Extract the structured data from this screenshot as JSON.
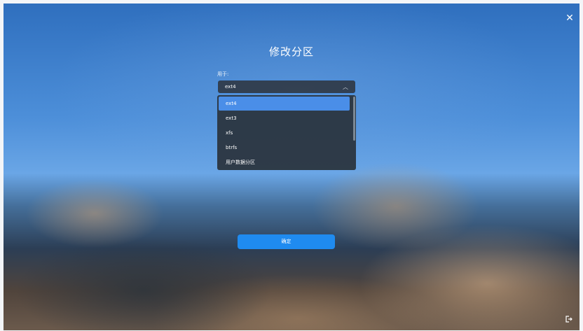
{
  "dialog": {
    "title": "修改分区",
    "close_icon": "close-icon",
    "field_label": "用于:",
    "select": {
      "value": "ext4",
      "chevron_icon": "chevron-up-icon"
    },
    "options": [
      {
        "label": "ext4",
        "selected": true
      },
      {
        "label": "ext3",
        "selected": false
      },
      {
        "label": "xfs",
        "selected": false
      },
      {
        "label": "btrfs",
        "selected": false
      },
      {
        "label": "用户数据分区",
        "selected": false
      }
    ],
    "confirm_label": "确定"
  },
  "footer": {
    "exit_icon": "logout-icon"
  },
  "colors": {
    "accent": "#1f8bf0",
    "selected_option": "#4a8ee8",
    "dropdown_bg": "#2c3642"
  }
}
